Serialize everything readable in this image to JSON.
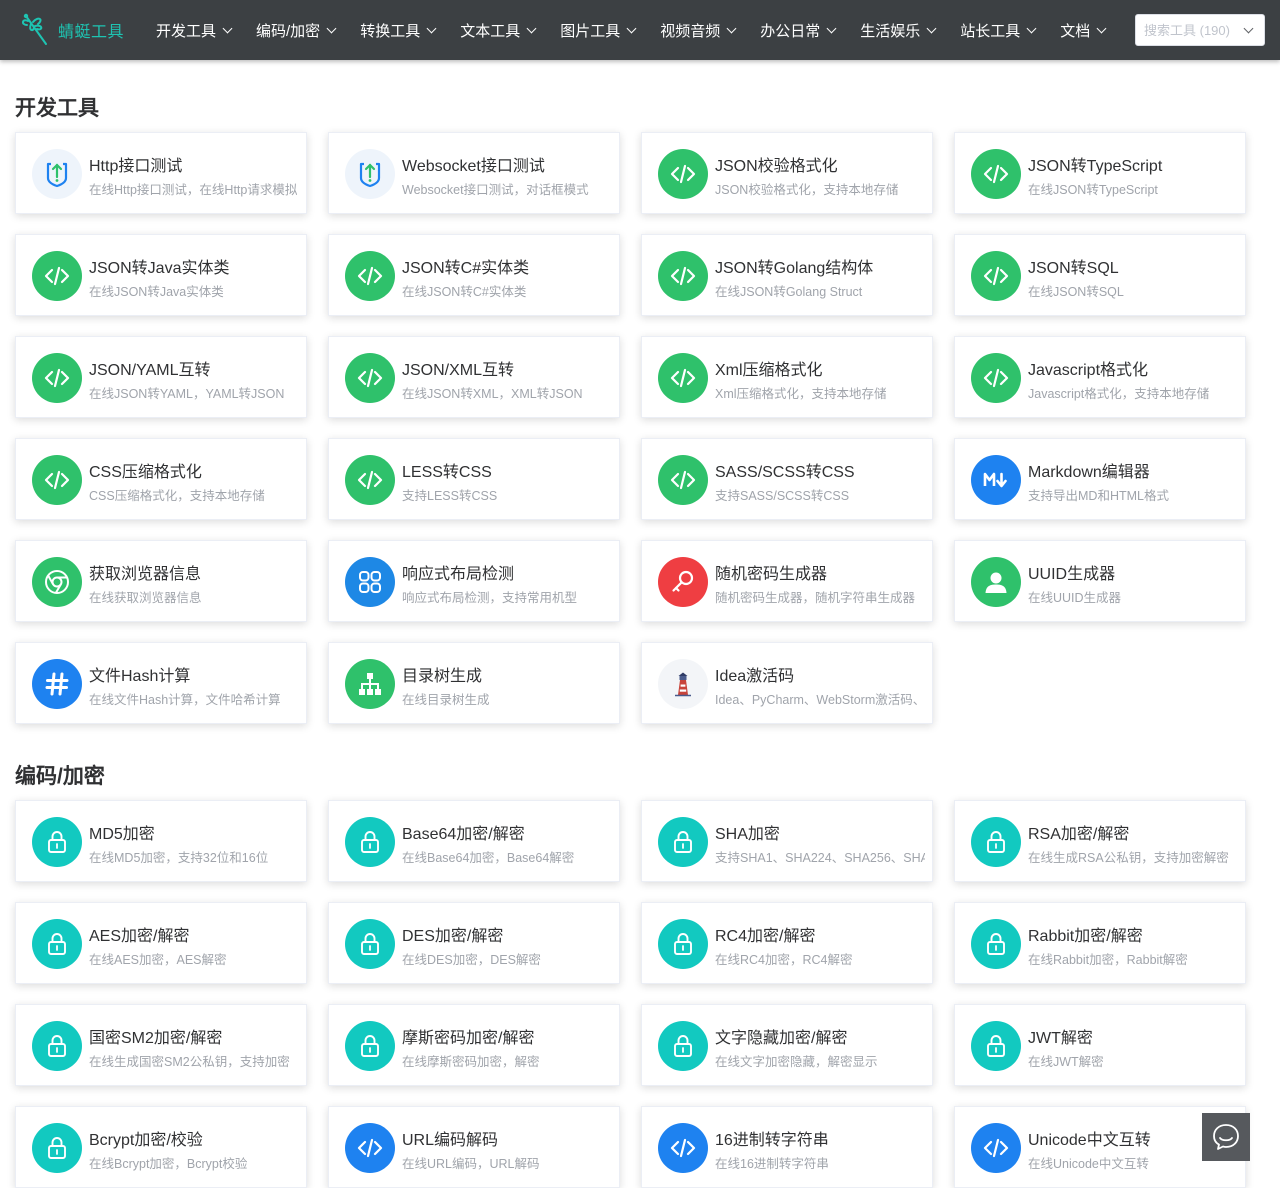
{
  "brand": {
    "name": "蜻蜓工具",
    "color": "#1ec4b2"
  },
  "nav": [
    {
      "label": "开发工具"
    },
    {
      "label": "编码/加密"
    },
    {
      "label": "转换工具"
    },
    {
      "label": "文本工具"
    },
    {
      "label": "图片工具"
    },
    {
      "label": "视频音频"
    },
    {
      "label": "办公日常"
    },
    {
      "label": "生活娱乐"
    },
    {
      "label": "站长工具"
    },
    {
      "label": "文档"
    }
  ],
  "search": {
    "placeholder": "搜索工具 (190)",
    "value": ""
  },
  "sections": [
    {
      "title": "开发工具",
      "tools": [
        {
          "title": "Http接口测试",
          "desc": "在线Http接口测试，在线Http请求模拟",
          "icon": "upload-shield-icon",
          "color": "#eef4fb"
        },
        {
          "title": "Websocket接口测试",
          "desc": "Websocket接口测试，对话框模式",
          "icon": "upload-shield-icon",
          "color": "#eef4fb"
        },
        {
          "title": "JSON校验格式化",
          "desc": "JSON校验格式化，支持本地存储",
          "icon": "code-icon",
          "color": "#2fc16b"
        },
        {
          "title": "JSON转TypeScript",
          "desc": "在线JSON转TypeScript",
          "icon": "code-icon",
          "color": "#2fc16b"
        },
        {
          "title": "JSON转Java实体类",
          "desc": "在线JSON转Java实体类",
          "icon": "code-icon",
          "color": "#2fc16b"
        },
        {
          "title": "JSON转C#实体类",
          "desc": "在线JSON转C#实体类",
          "icon": "code-icon",
          "color": "#2fc16b"
        },
        {
          "title": "JSON转Golang结构体",
          "desc": "在线JSON转Golang Struct",
          "icon": "code-icon",
          "color": "#2fc16b"
        },
        {
          "title": "JSON转SQL",
          "desc": "在线JSON转SQL",
          "icon": "code-icon",
          "color": "#2fc16b"
        },
        {
          "title": "JSON/YAML互转",
          "desc": "在线JSON转YAML，YAML转JSON",
          "icon": "code-icon",
          "color": "#2fc16b"
        },
        {
          "title": "JSON/XML互转",
          "desc": "在线JSON转XML，XML转JSON",
          "icon": "code-icon",
          "color": "#2fc16b"
        },
        {
          "title": "Xml压缩格式化",
          "desc": "Xml压缩格式化，支持本地存储",
          "icon": "code-icon",
          "color": "#2fc16b"
        },
        {
          "title": "Javascript格式化",
          "desc": "Javascript格式化，支持本地存储",
          "icon": "code-icon",
          "color": "#2fc16b"
        },
        {
          "title": "CSS压缩格式化",
          "desc": "CSS压缩格式化，支持本地存储",
          "icon": "code-icon",
          "color": "#2fc16b"
        },
        {
          "title": "LESS转CSS",
          "desc": "支持LESS转CSS",
          "icon": "code-icon",
          "color": "#2fc16b"
        },
        {
          "title": "SASS/SCSS转CSS",
          "desc": "支持SASS/SCSS转CSS",
          "icon": "code-icon",
          "color": "#2fc16b"
        },
        {
          "title": "Markdown编辑器",
          "desc": "支持导出MD和HTML格式",
          "icon": "markdown-icon",
          "color": "#1e82f0"
        },
        {
          "title": "获取浏览器信息",
          "desc": "在线获取浏览器信息",
          "icon": "chrome-icon",
          "color": "#2fc16b"
        },
        {
          "title": "响应式布局检测",
          "desc": "响应式布局检测，支持常用机型",
          "icon": "layout-grid-icon",
          "color": "#1e88e5"
        },
        {
          "title": "随机密码生成器",
          "desc": "随机密码生成器，随机字符串生成器",
          "icon": "key-icon",
          "color": "#ef3e42"
        },
        {
          "title": "UUID生成器",
          "desc": "在线UUID生成器",
          "icon": "user-icon",
          "color": "#2fc16b"
        },
        {
          "title": "文件Hash计算",
          "desc": "在线文件Hash计算，文件哈希计算",
          "icon": "hash-icon",
          "color": "#1e82f0"
        },
        {
          "title": "目录树生成",
          "desc": "在线目录树生成",
          "icon": "sitemap-icon",
          "color": "#2fc16b"
        },
        {
          "title": "Idea激活码",
          "desc": "Idea、PyCharm、WebStorm激活码、",
          "icon": "lighthouse-icon",
          "color": "#f3f5f8"
        }
      ]
    },
    {
      "title": "编码/加密",
      "tools": [
        {
          "title": "MD5加密",
          "desc": "在线MD5加密，支持32位和16位",
          "icon": "lock-icon",
          "color": "#12c9c0"
        },
        {
          "title": "Base64加密/解密",
          "desc": "在线Base64加密，Base64解密",
          "icon": "lock-icon",
          "color": "#12c9c0"
        },
        {
          "title": "SHA加密",
          "desc": "支持SHA1、SHA224、SHA256、SHA",
          "icon": "lock-icon",
          "color": "#12c9c0"
        },
        {
          "title": "RSA加密/解密",
          "desc": "在线生成RSA公私钥，支持加密解密",
          "icon": "lock-icon",
          "color": "#12c9c0"
        },
        {
          "title": "AES加密/解密",
          "desc": "在线AES加密，AES解密",
          "icon": "lock-icon",
          "color": "#12c9c0"
        },
        {
          "title": "DES加密/解密",
          "desc": "在线DES加密，DES解密",
          "icon": "lock-icon",
          "color": "#12c9c0"
        },
        {
          "title": "RC4加密/解密",
          "desc": "在线RC4加密，RC4解密",
          "icon": "lock-icon",
          "color": "#12c9c0"
        },
        {
          "title": "Rabbit加密/解密",
          "desc": "在线Rabbit加密，Rabbit解密",
          "icon": "lock-icon",
          "color": "#12c9c0"
        },
        {
          "title": "国密SM2加密/解密",
          "desc": "在线生成国密SM2公私钥，支持加密",
          "icon": "lock-icon",
          "color": "#12c9c0"
        },
        {
          "title": "摩斯密码加密/解密",
          "desc": "在线摩斯密码加密，解密",
          "icon": "lock-icon",
          "color": "#12c9c0"
        },
        {
          "title": "文字隐藏加密/解密",
          "desc": "在线文字加密隐藏，解密显示",
          "icon": "lock-icon",
          "color": "#12c9c0"
        },
        {
          "title": "JWT解密",
          "desc": "在线JWT解密",
          "icon": "lock-icon",
          "color": "#12c9c0"
        },
        {
          "title": "Bcrypt加密/校验",
          "desc": "在线Bcrypt加密，Bcrypt校验",
          "icon": "lock-icon",
          "color": "#12c9c0"
        },
        {
          "title": "URL编码解码",
          "desc": "在线URL编码，URL解码",
          "icon": "code-icon",
          "color": "#1e82f0"
        },
        {
          "title": "16进制转字符串",
          "desc": "在线16进制转字符串",
          "icon": "code-icon",
          "color": "#1e82f0"
        },
        {
          "title": "Unicode中文互转",
          "desc": "在线Unicode中文互转",
          "icon": "code-icon",
          "color": "#1e82f0"
        }
      ]
    }
  ],
  "chat": {
    "icon": "chat-bubble-icon"
  }
}
